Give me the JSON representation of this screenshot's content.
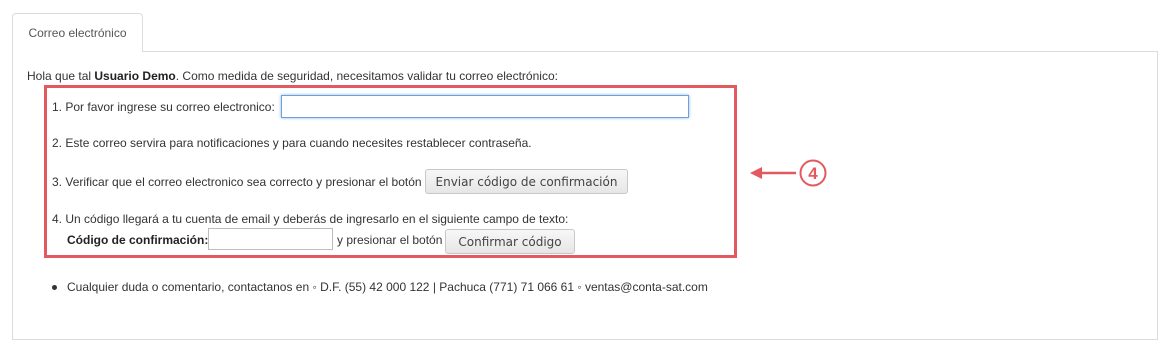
{
  "tab": {
    "label": "Correo electrónico"
  },
  "intro": {
    "prefix": "Hola que tal ",
    "user": "Usuario Demo",
    "suffix": ". Como medida de seguridad, necesitamos validar tu correo electrónico:"
  },
  "steps": [
    {
      "number": "1.",
      "text": "Por favor ingrese su correo electronico:"
    },
    {
      "number": "2.",
      "text": "Este correo servira para notificaciones y para cuando necesites restablecer contraseña."
    },
    {
      "number": "3.",
      "text": "Verificar que el correo electronico sea correcto y presionar el botón"
    },
    {
      "number": "4.",
      "text": "Un código llegará a tu cuenta de email y deberás de ingresarlo en el siguiente campo de texto:"
    }
  ],
  "email_input": {
    "value": "",
    "placeholder": ""
  },
  "send_button": {
    "label": "Enviar código de confirmación"
  },
  "code": {
    "label": "Código de confirmación:",
    "value": "",
    "after_text": "y presionar el botón"
  },
  "confirm_button": {
    "label": "Confirmar código"
  },
  "annotation": {
    "number": "4",
    "color": "#e25a5f"
  },
  "contact": {
    "text": "Cualquier duda o comentario, contactanos en ◦ D.F. (55) 42 000 122 | Pachuca (771) 71 066 61 ◦ ventas@conta-sat.com"
  }
}
